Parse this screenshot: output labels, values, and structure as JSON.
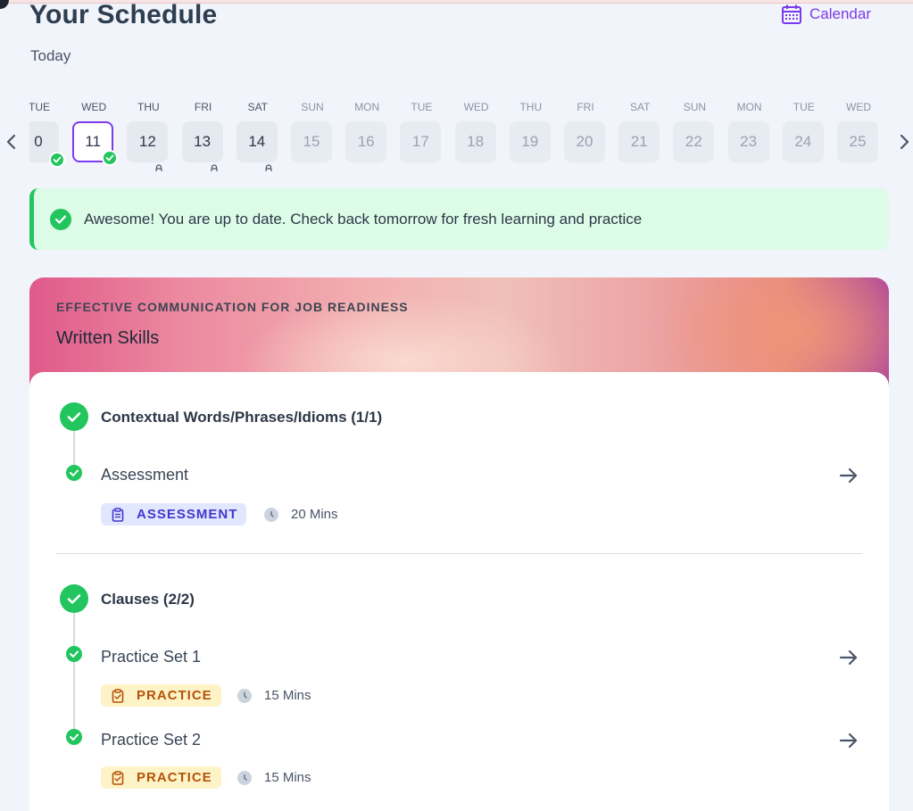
{
  "header": {
    "title": "Your Schedule",
    "subtitle": "Today",
    "calendar_label": "Calendar"
  },
  "days": [
    {
      "dow": "TUE",
      "num": "0",
      "state": "done"
    },
    {
      "dow": "WED",
      "num": "11",
      "state": "selected"
    },
    {
      "dow": "THU",
      "num": "12",
      "state": "locked"
    },
    {
      "dow": "FRI",
      "num": "13",
      "state": "locked"
    },
    {
      "dow": "SAT",
      "num": "14",
      "state": "locked"
    },
    {
      "dow": "SUN",
      "num": "15",
      "state": "future"
    },
    {
      "dow": "MON",
      "num": "16",
      "state": "future"
    },
    {
      "dow": "TUE",
      "num": "17",
      "state": "future"
    },
    {
      "dow": "WED",
      "num": "18",
      "state": "future"
    },
    {
      "dow": "THU",
      "num": "19",
      "state": "future"
    },
    {
      "dow": "FRI",
      "num": "20",
      "state": "future"
    },
    {
      "dow": "SAT",
      "num": "21",
      "state": "future"
    },
    {
      "dow": "SUN",
      "num": "22",
      "state": "future"
    },
    {
      "dow": "MON",
      "num": "23",
      "state": "future"
    },
    {
      "dow": "TUE",
      "num": "24",
      "state": "future"
    },
    {
      "dow": "WED",
      "num": "25",
      "state": "future"
    }
  ],
  "banner": {
    "text": "Awesome! You are up to date. Check back tomorrow for fresh learning and practice"
  },
  "course": {
    "tag": "EFFECTIVE COMMUNICATION FOR JOB READINESS",
    "name": "Written Skills",
    "topics": [
      {
        "title": "Contextual Words/Phrases/Idioms (1/1)",
        "items": [
          {
            "title": "Assessment",
            "badge": "ASSESSMENT",
            "duration": "20 Mins"
          }
        ]
      },
      {
        "title": "Clauses (2/2)",
        "items": [
          {
            "title": "Practice Set 1",
            "badge": "PRACTICE",
            "duration": "15 Mins"
          },
          {
            "title": "Practice Set 2",
            "badge": "PRACTICE",
            "duration": "15 Mins"
          }
        ]
      }
    ]
  },
  "colors": {
    "accent": "#7c3aed",
    "success": "#22c55e",
    "assessment_badge": "#e0e7ff",
    "practice_badge": "#fef3c7"
  }
}
